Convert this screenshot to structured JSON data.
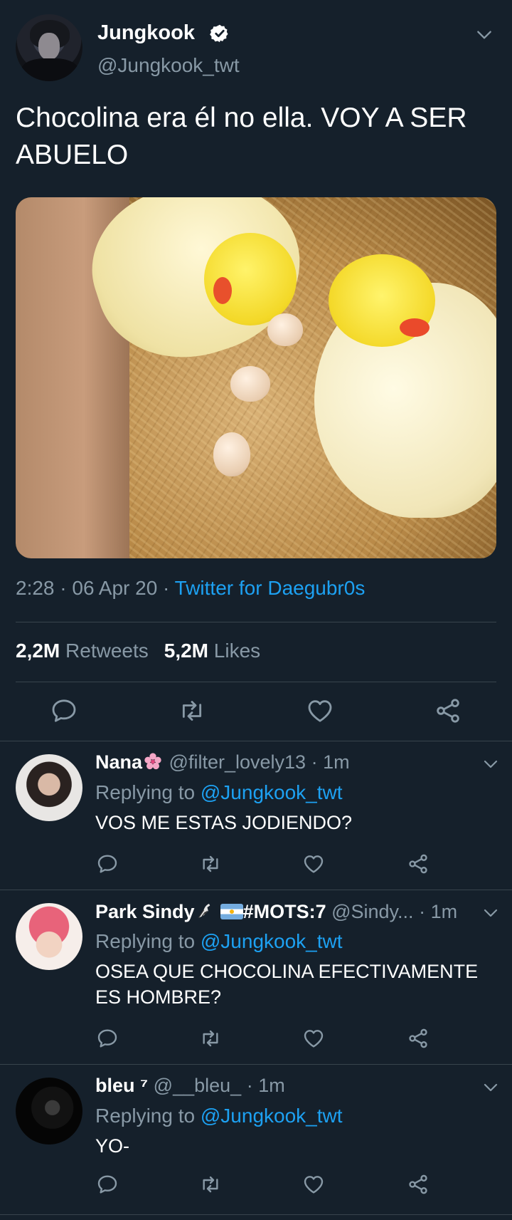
{
  "tweet": {
    "display_name": "Jungkook",
    "handle": "@Jungkook_twt",
    "text": "Chocolina era él no ella. VOY A SER ABUELO",
    "time": "2:28",
    "date": "06 Apr 20",
    "separator": "·",
    "source": "Twitter for Daegubr0s",
    "retweets_count": "2,2M",
    "retweets_label": "Retweets",
    "likes_count": "5,2M",
    "likes_label": "Likes"
  },
  "replies": [
    {
      "name": "Nana",
      "handle": "@filter_lovely13",
      "time": "1m",
      "replying_prefix": "Replying to",
      "replying_to": "@Jungkook_twt",
      "text": "VOS ME ESTAS JODIENDO?"
    },
    {
      "name": "Park Sindy",
      "name_suffix": "#MOTS:7",
      "handle": "@Sindy...",
      "time": "1m",
      "replying_prefix": "Replying to",
      "replying_to": "@Jungkook_twt",
      "text": "OSEA QUE CHOCOLINA EFECTIVAMENTE ES HOMBRE?"
    },
    {
      "name": "bleu ⁷",
      "handle": "@__bleu_",
      "time": "1m",
      "replying_prefix": "Replying to",
      "replying_to": "@Jungkook_twt",
      "text": "YO-"
    }
  ],
  "icons": {
    "reply": "reply-icon",
    "retweet": "retweet-icon",
    "like": "heart-icon",
    "share": "share-icon",
    "verified": "verified-badge-icon",
    "menu": "chevron-down-icon",
    "flower_emoji": "cherry-blossom-icon",
    "bird_emoji": "bird-icon",
    "flag_emoji": "argentina-flag-icon"
  },
  "colors": {
    "background": "#15202b",
    "accent": "#1da1f2",
    "secondary_text": "#8899a6",
    "divider": "#38444d"
  }
}
